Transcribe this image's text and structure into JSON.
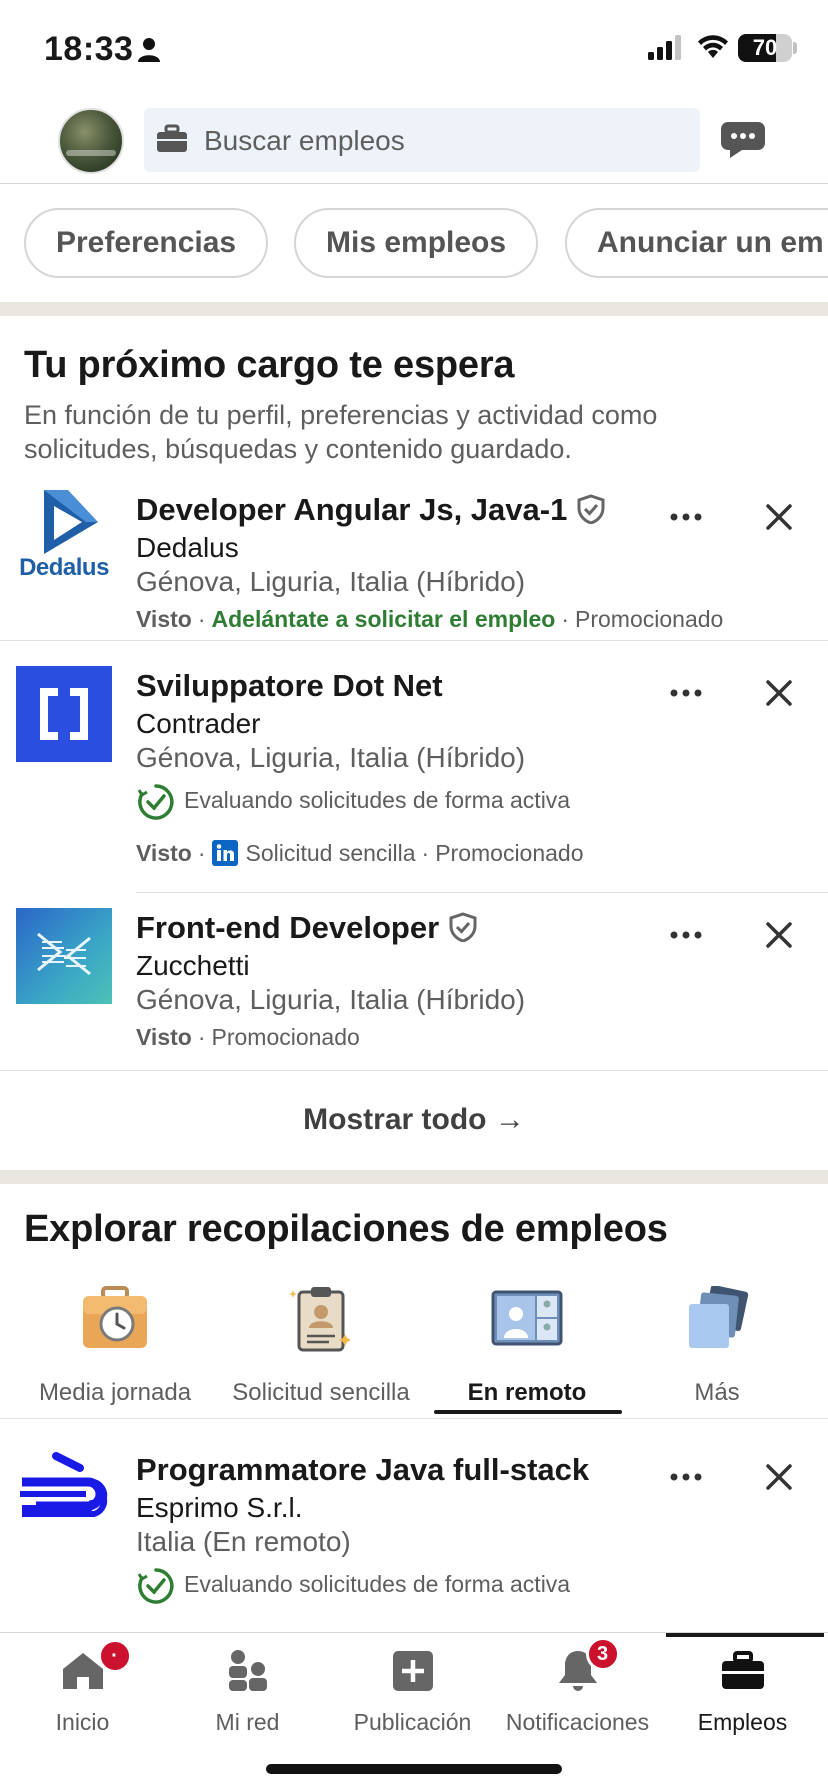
{
  "status_bar": {
    "time": "18:33",
    "battery": "70",
    "battery_level": 0.7
  },
  "header": {
    "search_placeholder": "Buscar empleos"
  },
  "chips": [
    "Preferencias",
    "Mis empleos",
    "Anunciar un em"
  ],
  "section1": {
    "title": "Tu próximo cargo te espera",
    "subtitle": "En función de tu perfil, preferencias y actividad como solicitudes, búsquedas y contenido guardado."
  },
  "jobs": [
    {
      "title": "Developer Angular Js, Java-1",
      "company": "Dedalus",
      "location": "Génova, Liguria, Italia (Híbrido)",
      "seen": "Visto",
      "highlight": "Adelántate a solicitar el empleo",
      "promoted": "Promocionado",
      "logo_text": "Dedalus"
    },
    {
      "title": "Sviluppatore Dot Net",
      "company": "Contrader",
      "location": "Génova, Liguria, Italia (Híbrido)",
      "active": "Evaluando solicitudes de forma activa",
      "seen": "Visto",
      "easy_apply": "Solicitud sencilla",
      "promoted": "Promocionado"
    },
    {
      "title": "Front-end Developer",
      "company": "Zucchetti",
      "location": "Génova, Liguria, Italia (Híbrido)",
      "seen": "Visto",
      "promoted": "Promocionado"
    }
  ],
  "show_all": "Mostrar todo →",
  "section2": {
    "title": "Explorar recopilaciones de empleos",
    "collections": [
      "Media jornada",
      "Solicitud sencilla",
      "En remoto",
      "Más"
    ],
    "active_collection": "En remoto"
  },
  "remote_job": {
    "title": "Programmatore Java full-stack",
    "company": "Esprimo S.r.l.",
    "location": "Italia (En remoto)",
    "active": "Evaluando solicitudes de forma activa"
  },
  "bottom_nav": {
    "items": [
      "Inicio",
      "Mi red",
      "Publicación",
      "Notificaciones",
      "Empleos"
    ],
    "notifications_badge": "3",
    "active": "Empleos"
  },
  "colors": {
    "green": "#2f7d32",
    "linkedin_blue": "#0a66c2",
    "badge_red": "#cb112d"
  }
}
